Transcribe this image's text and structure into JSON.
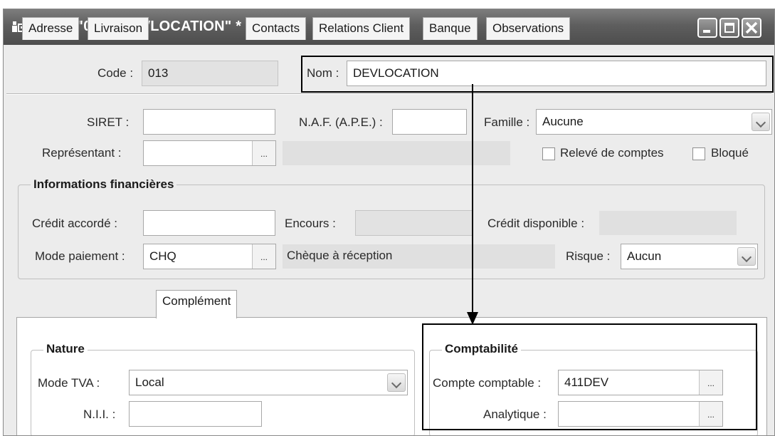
{
  "window": {
    "title": "Client \"013 - DEVLOCATION\" *"
  },
  "header": {
    "code_label": "Code :",
    "code_value": "013",
    "nom_label": "Nom :",
    "nom_value": "DEVLOCATION"
  },
  "general": {
    "siret_label": "SIRET :",
    "siret_value": "",
    "naf_label": "N.A.F. (A.P.E.) :",
    "naf_value": "",
    "famille_label": "Famille :",
    "famille_value": "Aucune",
    "representant_label": "Représentant :",
    "representant_value": "",
    "releve_label": "Relevé de comptes",
    "releve_checked": false,
    "bloque_label": "Bloqué",
    "bloque_checked": false
  },
  "financial": {
    "group_title": "Informations financières",
    "credit_accorde_label": "Crédit accordé :",
    "credit_accorde_value": "",
    "encours_label": "Encours :",
    "encours_value": "",
    "credit_disponible_label": "Crédit disponible :",
    "credit_disponible_value": "",
    "mode_paiement_label": "Mode paiement :",
    "mode_paiement_value": "CHQ",
    "mode_paiement_desc": "Chèque à réception",
    "risque_label": "Risque :",
    "risque_value": "Aucun"
  },
  "tabs": [
    {
      "label": "Adresse",
      "active": false
    },
    {
      "label": "Livraison",
      "active": false
    },
    {
      "label": "Complément",
      "active": true
    },
    {
      "label": "Contacts",
      "active": false
    },
    {
      "label": "Relations Client",
      "active": false
    },
    {
      "label": "Banque",
      "active": false
    },
    {
      "label": "Observations",
      "active": false
    }
  ],
  "complement": {
    "nature_title": "Nature",
    "mode_tva_label": "Mode TVA :",
    "mode_tva_value": "Local",
    "nii_label": "N.I.I. :",
    "nii_value": "",
    "compta_title": "Comptabilité",
    "compte_comptable_label": "Compte comptable :",
    "compte_comptable_value": "411DEV",
    "analytique_label": "Analytique :",
    "analytique_value": ""
  },
  "buttons": {
    "ellipsis": "..."
  },
  "colors": {
    "titlebar": "#5e5e5e",
    "window_bg": "#ececec",
    "annotation": "#000000"
  }
}
